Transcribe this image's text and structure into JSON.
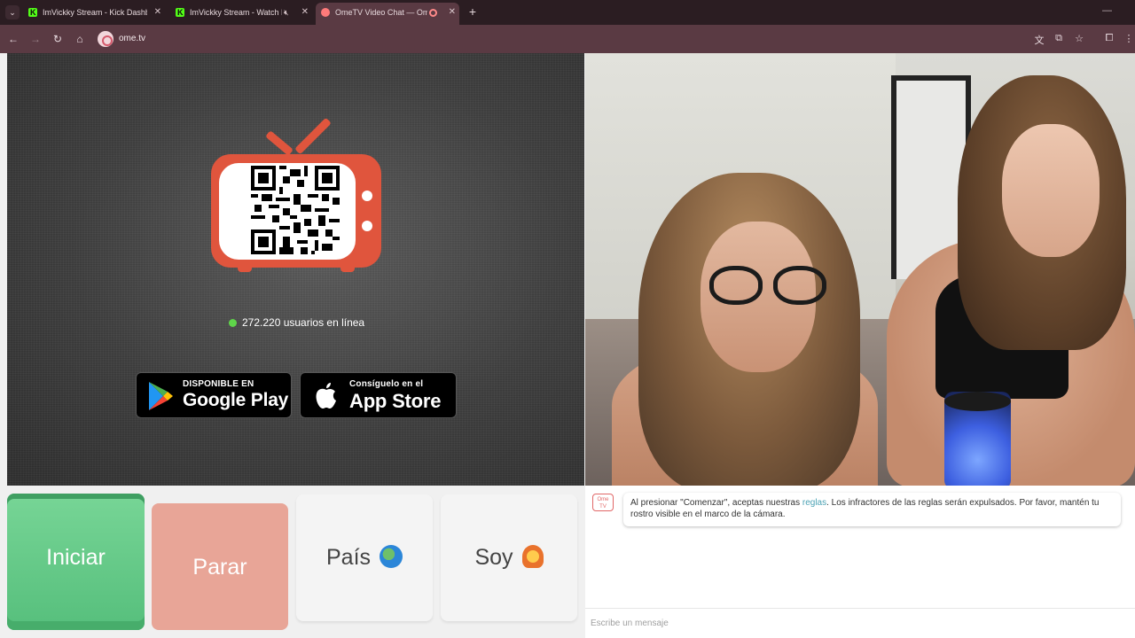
{
  "browser": {
    "tabs": [
      {
        "title": "ImVickky Stream - Kick Dashboard",
        "favicon": "kick-icon"
      },
      {
        "title": "ImVickky Stream - Watch Live",
        "favicon": "kick-icon",
        "muted": true
      },
      {
        "title": "OmeTV Video Chat — OmeTV",
        "favicon": "ometv-icon",
        "recording": true
      }
    ],
    "url": "ome.tv",
    "colors": {
      "tabbar": "#2b1d22",
      "toolbar": "#5a3a43"
    }
  },
  "left_pane": {
    "online_text": "272.220 usuarios en línea",
    "online_dot_color": "#5fd64a",
    "google_play": {
      "small": "DISPONIBLE EN",
      "big": "Google Play"
    },
    "app_store": {
      "small": "Consíguelo en el",
      "big": "App Store"
    },
    "tv_color": "#e0553d"
  },
  "controls": {
    "start_label": "Iniciar",
    "stop_label": "Parar",
    "country_label": "País",
    "me_label": "Soy",
    "start_color": "#5cc482",
    "stop_color": "#e8a597"
  },
  "chat": {
    "logo_text": "Ome TV",
    "rules_prefix": "Al presionar \"Comenzar\", aceptas nuestras ",
    "rules_link": "reglas",
    "rules_suffix": ". Los infractores de las reglas serán expulsados. Por favor, mantén tu rostro visible en el marco de la cámara.",
    "input_placeholder": "Escribe un mensaje"
  }
}
